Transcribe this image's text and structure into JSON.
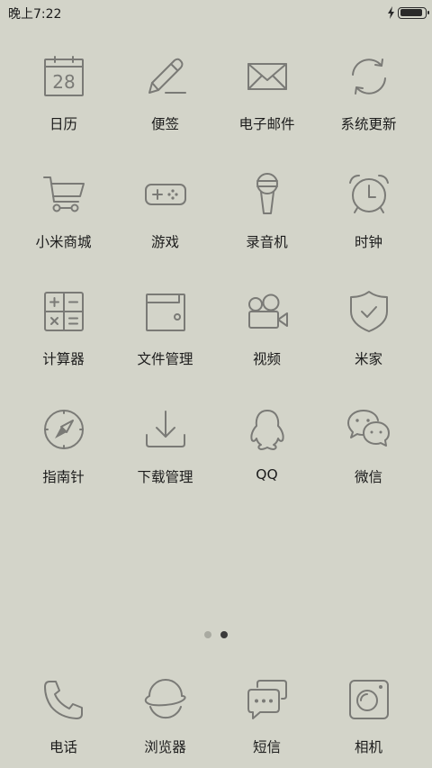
{
  "status": {
    "time": "晚上7:22",
    "battery_level": 0.9
  },
  "apps": [
    {
      "id": "calendar",
      "label": "日历",
      "icon": "calendar-icon",
      "date": "28"
    },
    {
      "id": "notes",
      "label": "便签",
      "icon": "pencil-icon"
    },
    {
      "id": "email",
      "label": "电子邮件",
      "icon": "envelope-icon"
    },
    {
      "id": "updater",
      "label": "系统更新",
      "icon": "refresh-icon"
    },
    {
      "id": "mall",
      "label": "小米商城",
      "icon": "cart-icon"
    },
    {
      "id": "games",
      "label": "游戏",
      "icon": "gamepad-icon"
    },
    {
      "id": "recorder",
      "label": "录音机",
      "icon": "microphone-icon"
    },
    {
      "id": "clock",
      "label": "时钟",
      "icon": "alarm-clock-icon"
    },
    {
      "id": "calculator",
      "label": "计算器",
      "icon": "calculator-icon"
    },
    {
      "id": "files",
      "label": "文件管理",
      "icon": "wallet-icon"
    },
    {
      "id": "video",
      "label": "视频",
      "icon": "video-camera-icon"
    },
    {
      "id": "mihome",
      "label": "米家",
      "icon": "shield-check-icon"
    },
    {
      "id": "compass",
      "label": "指南针",
      "icon": "compass-icon"
    },
    {
      "id": "downloads",
      "label": "下载管理",
      "icon": "download-icon"
    },
    {
      "id": "qq",
      "label": "QQ",
      "icon": "penguin-icon"
    },
    {
      "id": "wechat",
      "label": "微信",
      "icon": "chat-bubbles-icon"
    }
  ],
  "page_indicator": {
    "count": 2,
    "active_index": 1
  },
  "dock": [
    {
      "id": "phone",
      "label": "电话",
      "icon": "phone-icon"
    },
    {
      "id": "browser",
      "label": "浏览器",
      "icon": "planet-icon"
    },
    {
      "id": "sms",
      "label": "短信",
      "icon": "message-icon"
    },
    {
      "id": "camera",
      "label": "相机",
      "icon": "camera-icon"
    }
  ]
}
